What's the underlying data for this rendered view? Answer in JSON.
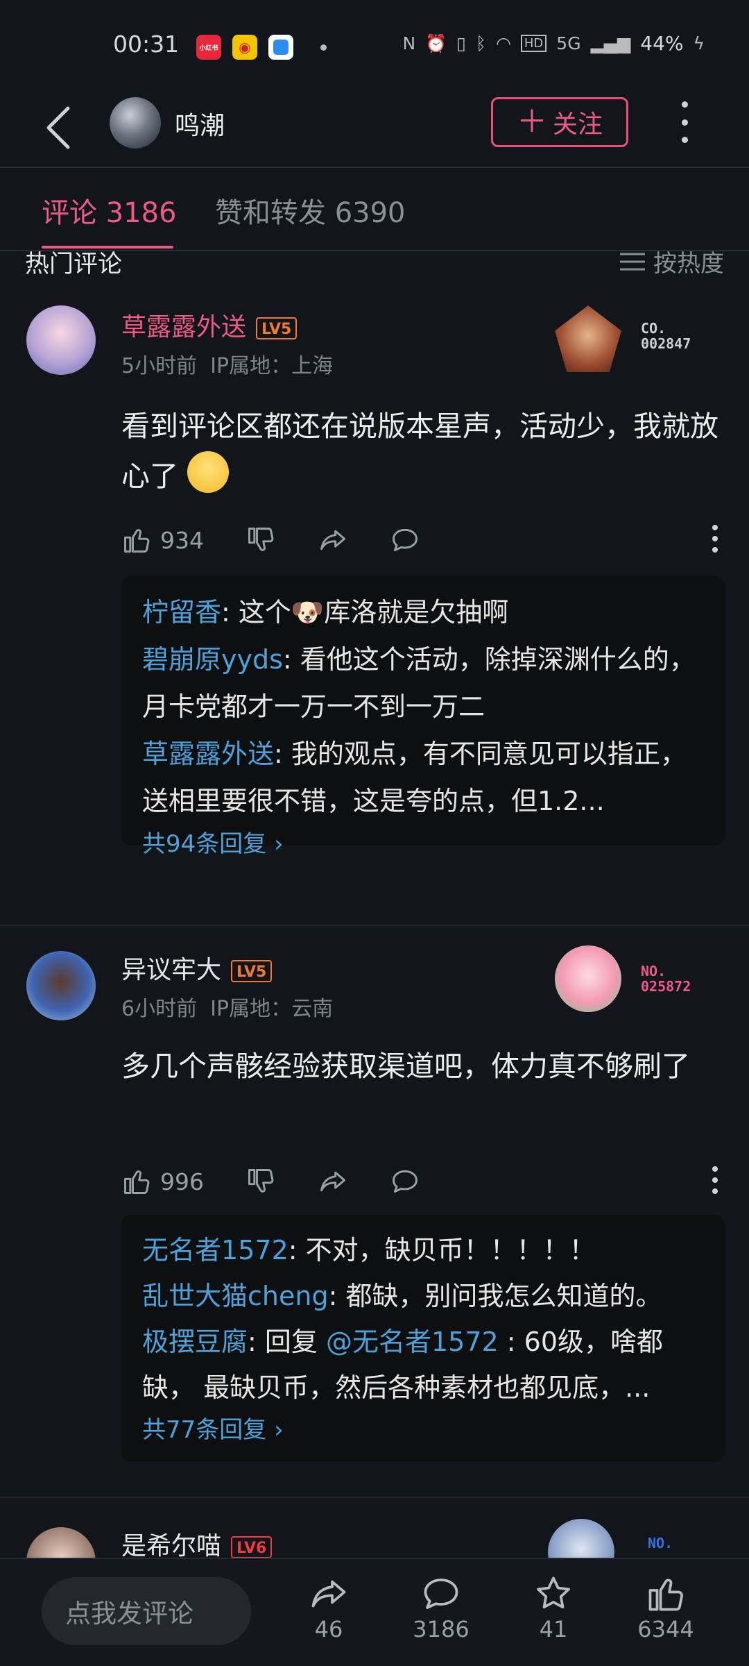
{
  "status_bar": {
    "time": "00:31",
    "app_icons": [
      "小红书",
      "微博",
      "蓝"
    ],
    "signal": "5G",
    "battery": "44%"
  },
  "header": {
    "username": "鸣潮",
    "follow_label": "关注"
  },
  "tabs": [
    {
      "label": "评论 3186"
    },
    {
      "label": "赞和转发 6390"
    }
  ],
  "section": {
    "title": "热门评论",
    "sort_label": "按热度"
  },
  "comments": [
    {
      "name": "草露露外送",
      "level": "LV5",
      "time": "5小时前",
      "ip": "IP属地：上海",
      "badge_no": [
        "CO.",
        "002847"
      ],
      "text": "看到评论区都还在说版本星声，活动少，我就放心了",
      "likes": "934",
      "replies": [
        {
          "name": "柠留香",
          "text": ": 这个🐶库洛就是欠抽啊"
        },
        {
          "name": "碧崩原yyds",
          "text": ": 看他这个活动，除掉深渊什么的，月卡党都才一万一不到一万二"
        },
        {
          "name": "草露露外送",
          "text": ": 我的观点，有不同意见可以指正，送相里要很不错，这是夸的点，但1.2..."
        }
      ],
      "more_replies": "共94条回复 ›"
    },
    {
      "name": "异议牢大",
      "level": "LV5",
      "time": "6小时前",
      "ip": "IP属地：云南",
      "badge_no": [
        "NO.",
        "025872"
      ],
      "text": "多几个声骸经验获取渠道吧，体力真不够刷了",
      "likes": "996",
      "replies": [
        {
          "name": "无名者1572",
          "text": ": 不对，缺贝币！！！！！"
        },
        {
          "name": "乱世大猫cheng",
          "text": ": 都缺，别问我怎么知道的。"
        },
        {
          "name": "极摆豆腐",
          "pre": ": 回复 ",
          "at": "@无名者1572",
          "text": " : 60级，啥都缺， 最缺贝币，然后各种素材也都见底，..."
        }
      ],
      "more_replies": "共77条回复 ›"
    },
    {
      "name": "是希尔喵",
      "level": "LV6",
      "badge_no": [
        "NO."
      ]
    }
  ],
  "bottom_bar": {
    "input_placeholder": "点我发评论",
    "share_count": "46",
    "comment_count": "3186",
    "fav_count": "41",
    "like_count": "6344"
  },
  "colors": {
    "accent": "#ee5a86",
    "link": "#4ea2d9",
    "bg": "#121519"
  }
}
